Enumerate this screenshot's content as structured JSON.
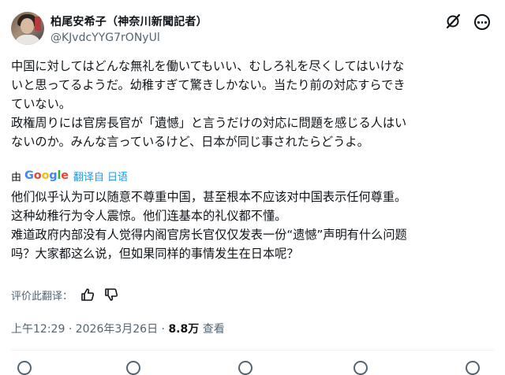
{
  "author": {
    "display_name": "柏尾安希子（神奈川新聞記者）",
    "handle": "@KJvdcYYG7rONyUl"
  },
  "post": {
    "lines": [
      "中国に対してはどんな無礼を働いてもいい、むしろ礼を尽くしてはいけな",
      "いと思ってるようだ。幼稚すぎて驚きしかない。当たり前の対応すらでき",
      "ていない。",
      "政権周りには官房長官が「遺憾」と言うだけの対応に問題を感じる人はい",
      "ないのか。みんな言っているけど、日本が同じ事されたらどうよ。"
    ]
  },
  "translation": {
    "by_label": "由",
    "provider": "Google",
    "from_label": "翻译自 日语",
    "lines": [
      "他们似乎认为可以随意不尊重中国，甚至根本不应该对中国表示任何尊重。",
      "这种幼稚行为令人震惊。他们连基本的礼仪都不懂。",
      "难道政府内部没有人觉得内阁官房长官仅仅发表一份“遗憾”声明有什么问题",
      "吗？大家都这么说，但如果同样的事情发生在日本呢？"
    ],
    "rate_label": "评价此翻译："
  },
  "meta": {
    "time": "上午12:29",
    "date": "2026年3月26日",
    "separator": "·",
    "views_count": "8.8万",
    "views_label": "查看"
  },
  "icons": {
    "grok": "grok-icon",
    "more": "more-options-icon",
    "thumbs_up": "thumbs-up-icon",
    "thumbs_down": "thumbs-down-icon"
  },
  "colors": {
    "text": "#0f1419",
    "secondary": "#536471",
    "link": "#1d9bf0"
  }
}
